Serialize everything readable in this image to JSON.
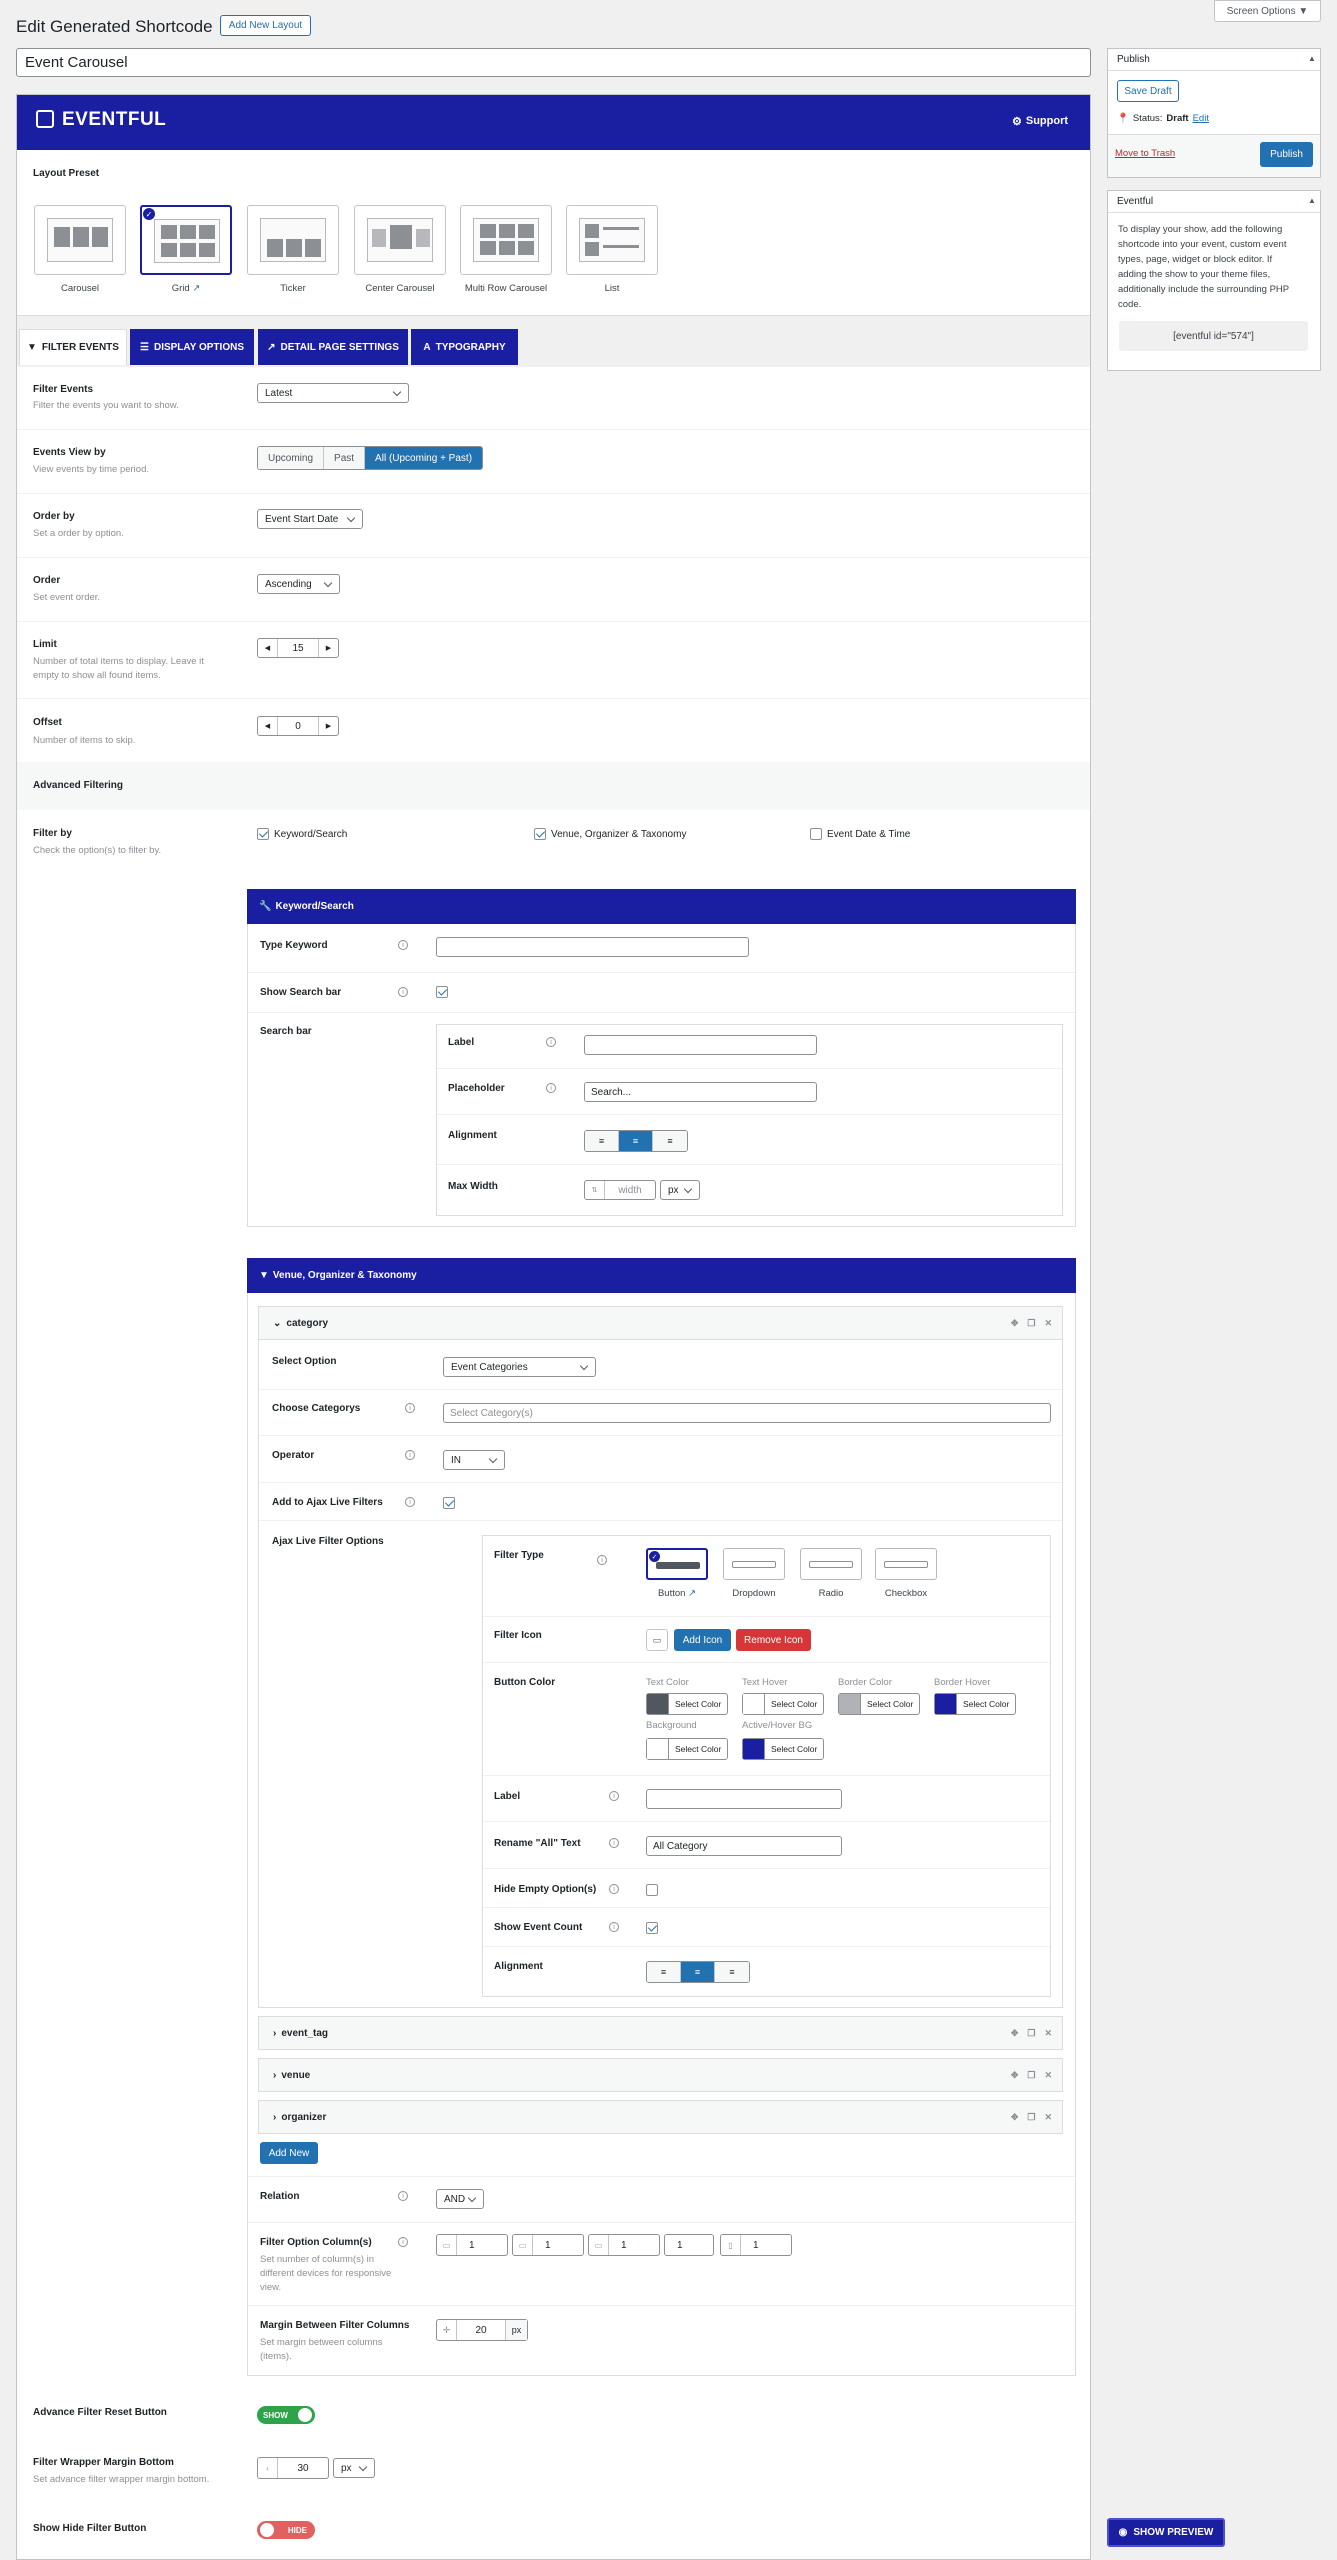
{
  "screen_options": "Screen Options ▼",
  "page_title": "Edit Generated Shortcode",
  "add_new_layout": "Add New Layout",
  "shortcode_title": "Event Carousel",
  "brand": {
    "name": "EVENTFUL",
    "support": "Support",
    "color": "#1a1ea0"
  },
  "layout_preset": {
    "label": "Layout Preset",
    "items": [
      {
        "name": "Carousel"
      },
      {
        "name": "Grid",
        "selected": true
      },
      {
        "name": "Ticker"
      },
      {
        "name": "Center Carousel"
      },
      {
        "name": "Multi Row Carousel"
      },
      {
        "name": "List"
      }
    ]
  },
  "tabs": [
    "FILTER EVENTS",
    "DISPLAY OPTIONS",
    "DETAIL PAGE SETTINGS",
    "TYPOGRAPHY"
  ],
  "fields": {
    "filter_events": {
      "label": "Filter Events",
      "desc": "Filter the events you want to show.",
      "value": "Latest"
    },
    "events_view": {
      "label": "Events View by",
      "desc": "View events by time period.",
      "options": [
        "Upcoming",
        "Past",
        "All (Upcoming + Past)"
      ],
      "selected": "All (Upcoming + Past)"
    },
    "order_by": {
      "label": "Order by",
      "desc": "Set a order by option.",
      "value": "Event Start Date"
    },
    "order": {
      "label": "Order",
      "desc": "Set event order.",
      "value": "Ascending"
    },
    "limit": {
      "label": "Limit",
      "desc1": "Number of total items to display. Leave it",
      "desc2": "empty to show all found items.",
      "value": "15"
    },
    "offset": {
      "label": "Offset",
      "desc": "Number of items to skip.",
      "value": "0"
    }
  },
  "advanced_filtering": "Advanced Filtering",
  "filter_by": {
    "label": "Filter by",
    "desc": "Check the option(s) to filter by.",
    "options": [
      {
        "label": "Keyword/Search",
        "checked": true
      },
      {
        "label": "Venue, Organizer & Taxonomy",
        "checked": true
      },
      {
        "label": "Event Date & Time",
        "checked": false
      }
    ]
  },
  "keyword_section": {
    "title": "Keyword/Search",
    "type_keyword": "Type Keyword",
    "show_search_bar": "Show Search bar",
    "search_bar": "Search bar",
    "label": "Label",
    "placeholder_label": "Placeholder",
    "placeholder_value": "Search...",
    "alignment": "Alignment",
    "max_width": "Max Width",
    "width_placeholder": "width",
    "unit": "px"
  },
  "venue_section": {
    "title": "Venue, Organizer & Taxonomy",
    "category": {
      "title": "category",
      "select_option": "Select Option",
      "select_option_value": "Event Categories",
      "choose_categorys": "Choose Categorys",
      "choose_placeholder": "Select Category(s)",
      "operator": "Operator",
      "operator_value": "IN",
      "ajax_live": "Add to Ajax Live Filters",
      "ajax_options": "Ajax Live Filter Options",
      "filter_type": "Filter Type",
      "filter_types": [
        "Button",
        "Dropdown",
        "Radio",
        "Checkbox"
      ],
      "filter_icon": "Filter Icon",
      "add_icon": "Add Icon",
      "remove_icon": "Remove Icon",
      "button_color": "Button Color",
      "colors": [
        {
          "label": "Text Color",
          "color": "#50575e"
        },
        {
          "label": "Text Hover",
          "color": "#ffffff"
        },
        {
          "label": "Border Color",
          "color": "#b0b2b8"
        },
        {
          "label": "Border Hover",
          "color": "#1a1ea0"
        },
        {
          "label": "Background",
          "color": "#ffffff"
        },
        {
          "label": "Active/Hover BG",
          "color": "#1a1ea0"
        }
      ],
      "select_color": "Select Color",
      "label": "Label",
      "rename_all": "Rename \"All\" Text",
      "rename_all_value": "All Category",
      "hide_empty": "Hide Empty Option(s)",
      "show_event_count": "Show Event Count",
      "alignment": "Alignment"
    },
    "folds": [
      "event_tag",
      "venue",
      "organizer"
    ],
    "add_new": "Add New",
    "relation": "Relation",
    "relation_value": "AND",
    "filter_columns": "Filter Option Column(s)",
    "filter_columns_desc": [
      "Set number of column(s) in",
      "different devices for responsive",
      "view."
    ],
    "column_values": [
      "1",
      "1",
      "1",
      "1",
      "1"
    ],
    "margin_between": "Margin Between Filter Columns",
    "margin_desc": [
      "Set margin between columns",
      "(items)."
    ],
    "margin_value": "20",
    "margin_unit": "px"
  },
  "reset_button": {
    "label": "Advance Filter Reset Button",
    "state": "SHOW"
  },
  "wrapper_margin": {
    "label": "Filter Wrapper Margin Bottom",
    "desc": "Set advance filter wrapper margin bottom.",
    "value": "30",
    "unit": "px"
  },
  "hide_filter": {
    "label": "Show Hide Filter Button",
    "state": "HIDE"
  },
  "publish_box": {
    "title": "Publish",
    "save_draft": "Save Draft",
    "status_label": "Status:",
    "status_value": "Draft",
    "edit": "Edit",
    "move_trash": "Move to Trash",
    "publish": "Publish"
  },
  "eventful_box": {
    "title": "Eventful",
    "text": [
      "To display your show, add the following",
      "shortcode into your event, custom event",
      "types, page, widget or block editor. If",
      "adding the show to your theme files,",
      "additionally include the surrounding PHP",
      "code."
    ],
    "shortcode": "[eventful id=\"574\"]"
  },
  "show_preview": "SHOW PREVIEW"
}
